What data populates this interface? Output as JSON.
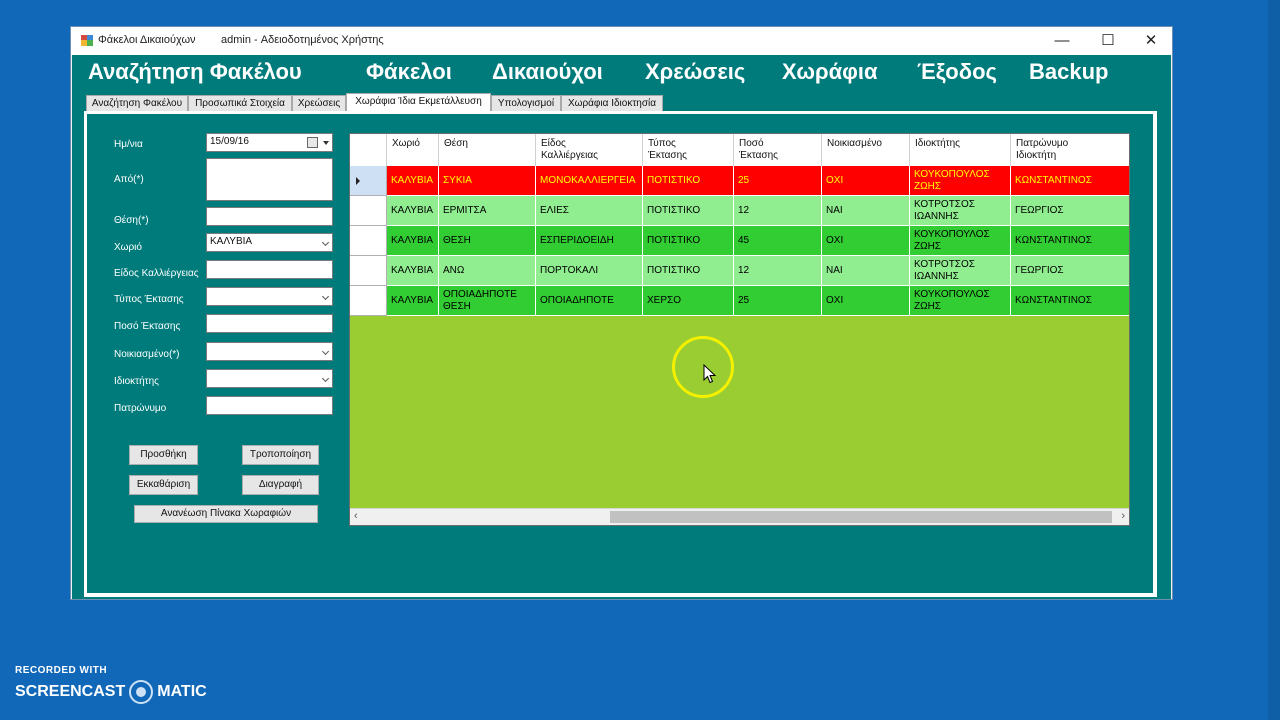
{
  "window": {
    "app_name": "Φάκελοι Δικαιούχων",
    "user": "admin - Αδειοδοτημένος Χρήστης",
    "controls": {
      "minimize": "—",
      "maximize": "☐",
      "close": "✕"
    }
  },
  "menu": [
    "Αναζήτηση Φακέλου",
    "Φάκελοι",
    "Δικαιούχοι",
    "Χρεώσεις",
    "Χωράφια",
    "Έξοδος",
    "Backup"
  ],
  "tabs": [
    {
      "label": "Αναζήτηση Φακέλου",
      "active": false
    },
    {
      "label": "Προσωπικά Στοιχεία",
      "active": false
    },
    {
      "label": "Χρεώσεις",
      "active": false
    },
    {
      "label": "Χωράφια Ίδια Εκμετάλλευση",
      "active": true
    },
    {
      "label": "Υπολογισμοί",
      "active": false
    },
    {
      "label": "Χωράφια Ιδιοκτησία",
      "active": false
    }
  ],
  "form": {
    "date_label": "Ημ/νια",
    "date_value": "15/09/16",
    "from_label": "Από(*)",
    "from_value": "",
    "position_label": "Θέση(*)",
    "position_value": "",
    "village_label": "Χωριό",
    "village_value": "ΚΑΛΥΒΙΑ",
    "crop_label": "Είδος Καλλιέργειας",
    "crop_value": "",
    "area_type_label": "Τύπος Έκτασης",
    "area_type_value": "",
    "area_amount_label": "Ποσό Έκτασης",
    "area_amount_value": "",
    "rented_label": "Νοικιασμένο(*)",
    "rented_value": "",
    "owner_label": "Ιδιοκτήτης",
    "owner_value": "",
    "patronymic_label": "Πατρώνυμο",
    "patronymic_value": ""
  },
  "buttons": {
    "add": "Προσθήκη",
    "modify": "Τροποποίηση",
    "clear": "Εκκαθάριση",
    "delete": "Διαγραφή",
    "refresh": "Ανανέωση Πίνακα Χωραφιών"
  },
  "grid": {
    "columns": [
      {
        "line1": "Χωριό",
        "line2": ""
      },
      {
        "line1": "Θέση",
        "line2": ""
      },
      {
        "line1": "Είδος",
        "line2": "Καλλιέργειας"
      },
      {
        "line1": "Τύπος",
        "line2": "Έκτασης"
      },
      {
        "line1": "Ποσό",
        "line2": "Έκτασης"
      },
      {
        "line1": "Νοικιασμένο",
        "line2": ""
      },
      {
        "line1": "Ιδιοκτήτης",
        "line2": ""
      },
      {
        "line1": "Πατρώνυμο",
        "line2": "Ιδιοκτήτη"
      }
    ],
    "rows": [
      {
        "cells": [
          "ΚΑΛΥΒΙΑ",
          "ΣΥΚΙΑ",
          "ΜΟΝΟΚΑΛΛΙΕΡΓΕΙΑ",
          "ΠΟΤΙΣΤΙΚΟ",
          "25",
          "ΟΧΙ",
          "ΚΟΥΚΟΠΟΥΛΟΣ ΖΩΗΣ",
          "ΚΩΝΣΤΑΝΤΙΝΟΣ"
        ],
        "bg": "#ff0000",
        "fg": "#ffff00",
        "selected": true
      },
      {
        "cells": [
          "ΚΑΛΥΒΙΑ",
          "ΕΡΜΙΤΣΑ",
          "ΕΛΙΕΣ",
          "ΠΟΤΙΣΤΙΚΟ",
          "12",
          "ΝΑΙ",
          "ΚΟΤΡΟΤΣΟΣ ΙΩΑΝΝΗΣ",
          "ΓΕΩΡΓΙΟΣ"
        ],
        "bg": "#90ee90",
        "fg": "#000000",
        "selected": false
      },
      {
        "cells": [
          "ΚΑΛΥΒΙΑ",
          "ΘΕΣΗ",
          "ΕΣΠΕΡΙΔΟΕΙΔΗ",
          "ΠΟΤΙΣΤΙΚΟ",
          "45",
          "ΟΧΙ",
          "ΚΟΥΚΟΠΟΥΛΟΣ ΖΩΗΣ",
          "ΚΩΝΣΤΑΝΤΙΝΟΣ"
        ],
        "bg": "#32cd32",
        "fg": "#000000",
        "selected": false
      },
      {
        "cells": [
          "ΚΑΛΥΒΙΑ",
          "ΑΝΩ",
          "ΠΟΡΤΟΚΑΛΙ",
          "ΠΟΤΙΣΤΙΚΟ",
          "12",
          "ΝΑΙ",
          "ΚΟΤΡΟΤΣΟΣ ΙΩΑΝΝΗΣ",
          "ΓΕΩΡΓΙΟΣ"
        ],
        "bg": "#90ee90",
        "fg": "#000000",
        "selected": false
      },
      {
        "cells": [
          "ΚΑΛΥΒΙΑ",
          "ΟΠΟΙΑΔΗΠΟΤΕ ΘΕΣΗ",
          "ΟΠΟΙΑΔΗΠΟΤΕ",
          "ΧΕΡΣΟ",
          "25",
          "ΟΧΙ",
          "ΚΟΥΚΟΠΟΥΛΟΣ ΖΩΗΣ",
          "ΚΩΝΣΤΑΝΤΙΝΟΣ"
        ],
        "bg": "#32cd32",
        "fg": "#000000",
        "selected": false
      }
    ],
    "empty_bg": "#9acd32"
  },
  "watermark": {
    "line1": "RECORDED WITH",
    "line2_left": "SCREENCAST",
    "line2_right": "MATIC"
  }
}
